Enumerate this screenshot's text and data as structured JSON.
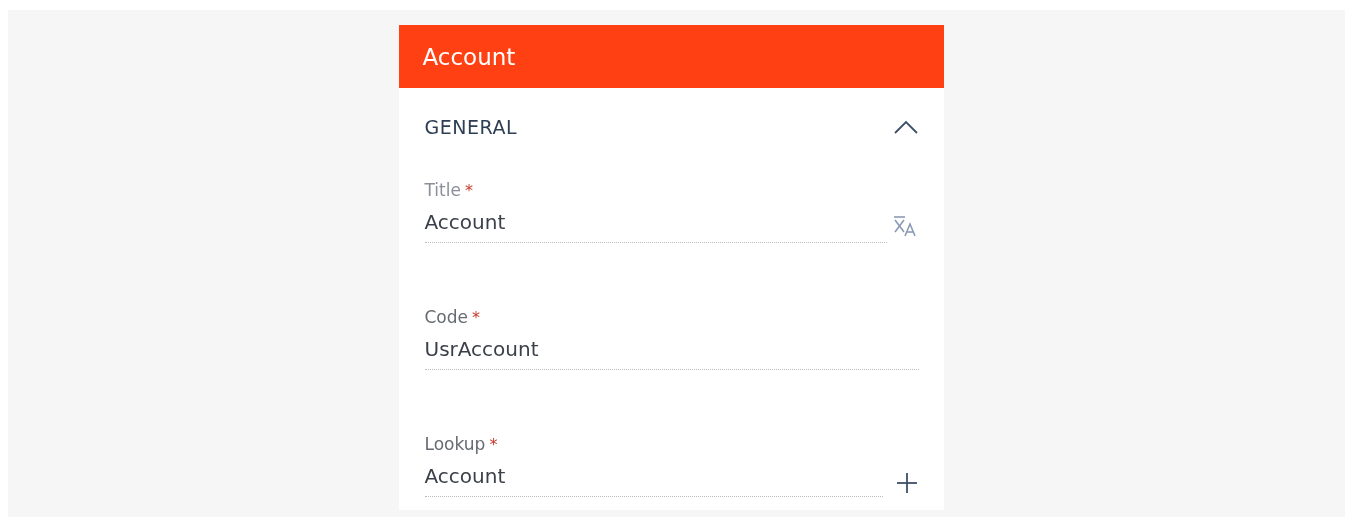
{
  "header": {
    "title": "Account"
  },
  "section": {
    "title": "GENERAL",
    "expanded": true
  },
  "fields": [
    {
      "kind": "translatable",
      "label": "Title",
      "required_mark": "*",
      "value": "Account"
    },
    {
      "kind": "text",
      "label": "Code",
      "required_mark": "*",
      "value": "UsrAccount"
    },
    {
      "kind": "lookup",
      "label": "Lookup",
      "required_mark": "*",
      "value": "Account"
    }
  ]
}
